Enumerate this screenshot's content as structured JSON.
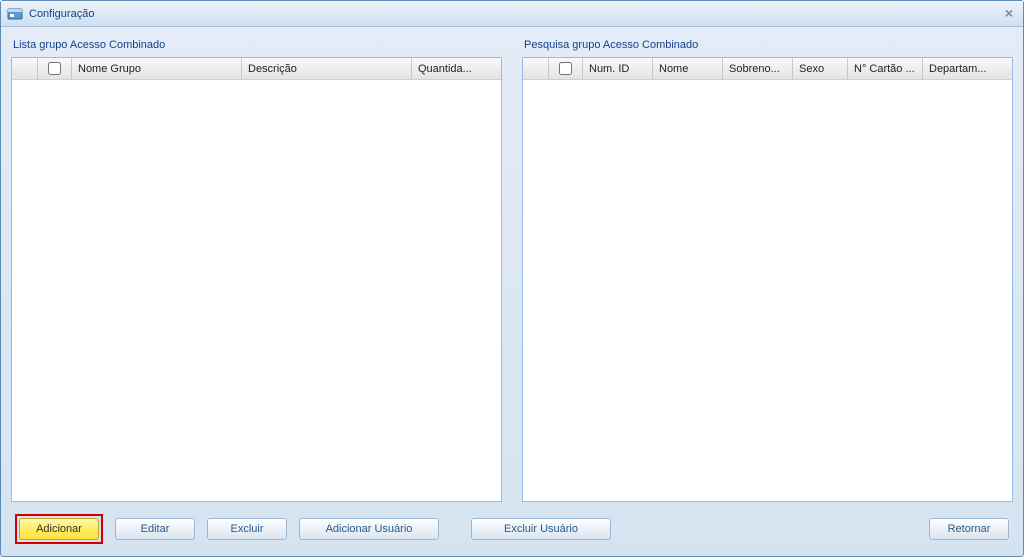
{
  "window": {
    "title": "Configuração"
  },
  "leftPanel": {
    "label": "Lista grupo Acesso Combinado",
    "columns": {
      "checkbox": "",
      "nomeGrupo": "Nome Grupo",
      "descricao": "Descrição",
      "quantidade": "Quantida..."
    },
    "rows": []
  },
  "rightPanel": {
    "label": "Pesquisa grupo Acesso Combinado",
    "columns": {
      "checkbox": "",
      "numId": "Num. ID",
      "nome": "Nome",
      "sobrenome": "Sobreno...",
      "sexo": "Sexo",
      "cartao": "N° Cartão ...",
      "departamento": "Departam..."
    },
    "rows": []
  },
  "buttons": {
    "adicionar": "Adicionar",
    "editar": "Editar",
    "excluir": "Excluir",
    "adicionarUsuario": "Adicionar Usuário",
    "excluirUsuario": "Excluir Usuário",
    "retornar": "Retornar"
  }
}
